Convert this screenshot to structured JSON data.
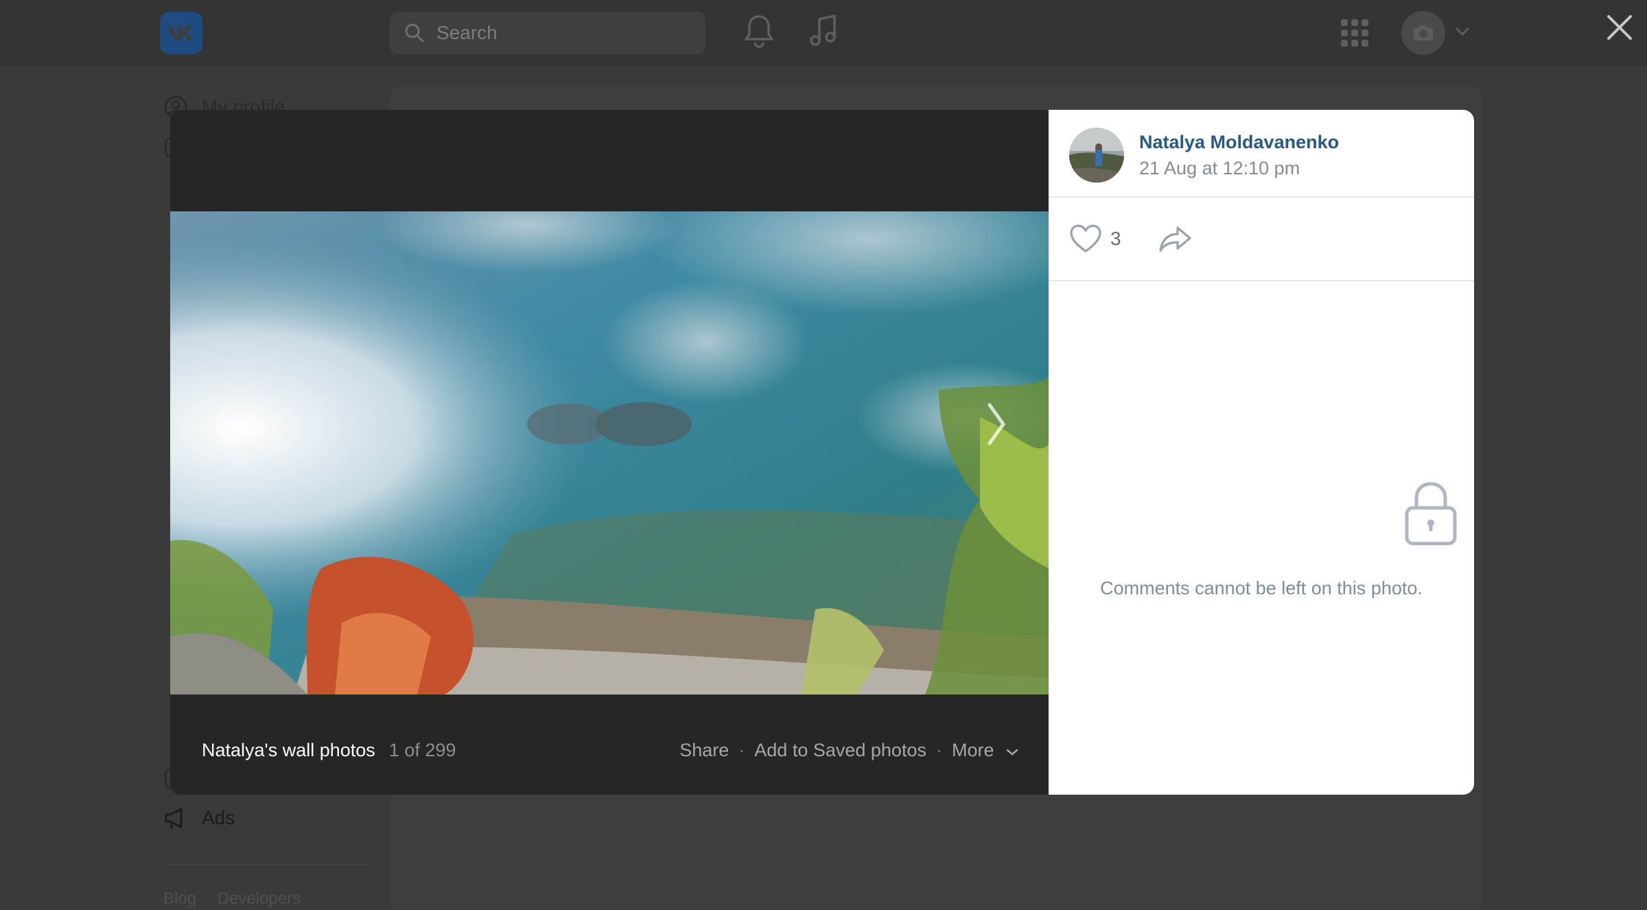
{
  "search": {
    "placeholder": "Search"
  },
  "left_nav": {
    "items": [
      {
        "label": "My profile",
        "icon": "user-circle-icon"
      },
      {
        "label": "Ads",
        "icon": "megaphone-icon"
      }
    ],
    "footer_links": [
      "Blog",
      "Developers"
    ]
  },
  "viewer": {
    "album_title": "Natalya's wall photos",
    "counter": "1 of 299",
    "actions": {
      "share": "Share",
      "add_saved": "Add to Saved photos",
      "more": "More",
      "separator": "·"
    },
    "author": {
      "name": "Natalya Moldavanenko",
      "date": "21 Aug at 12:10 pm"
    },
    "likes": "3",
    "comments_note": "Comments cannot be left on this photo."
  },
  "colors": {
    "link": "#2a5885",
    "muted": "#818c99",
    "overlay_bg": "#262626"
  }
}
